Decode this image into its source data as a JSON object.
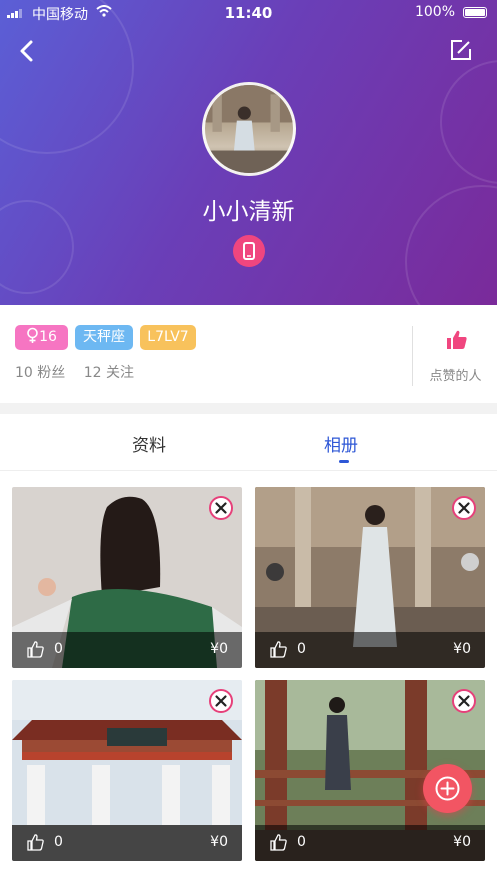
{
  "status_bar": {
    "carrier": "中国移动",
    "time": "11:40",
    "battery": "100%"
  },
  "profile": {
    "username": "小小清新",
    "badges": [
      {
        "label": "16",
        "color": "#f675c2"
      },
      {
        "label": "天秤座",
        "color": "#6db8f2"
      },
      {
        "label": "L7LV7",
        "color": "#f8c25c"
      }
    ],
    "followers": "10 粉丝",
    "following": "12 关注",
    "likers_label": "点赞的人"
  },
  "tabs": [
    {
      "label": "资料",
      "active": false
    },
    {
      "label": "相册",
      "active": true
    }
  ],
  "photos": [
    {
      "likes": "0",
      "price": "¥0"
    },
    {
      "likes": "0",
      "price": "¥0"
    },
    {
      "likes": "0",
      "price": "¥0"
    },
    {
      "likes": "0",
      "price": "¥0"
    }
  ],
  "colors": {
    "accent": "#2e57d6",
    "pink": "#f0467f",
    "fab": "#f25563"
  },
  "icons": {
    "back": "chevron-left-icon",
    "edit": "edit-icon",
    "device": "phone-icon",
    "like": "thumbs-up-icon",
    "remove": "close-icon",
    "add": "plus-icon"
  }
}
